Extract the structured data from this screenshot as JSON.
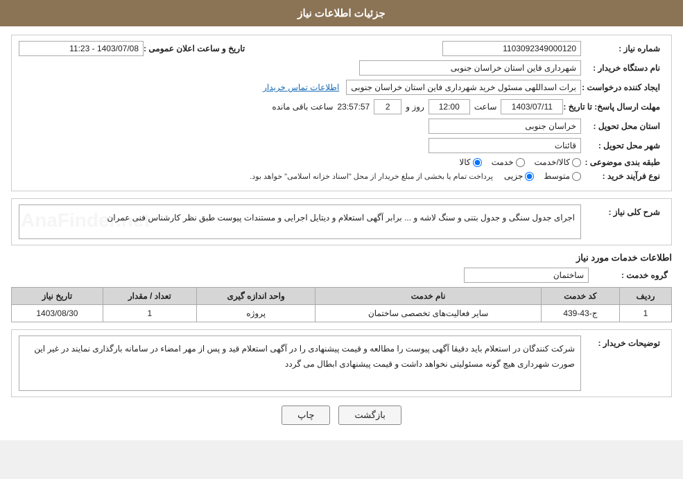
{
  "header": {
    "title": "جزئیات اطلاعات نیاز"
  },
  "fields": {
    "need_number_label": "شماره نیاز :",
    "need_number_value": "1103092349000120",
    "announcement_date_label": "تاریخ و ساعت اعلان عمومی :",
    "announcement_date_value": "1403/07/08 - 11:23",
    "buyer_org_label": "نام دستگاه خریدار :",
    "buyer_org_value": "شهرداری فاین استان خراسان جنوبی",
    "creator_label": "ایجاد کننده درخواست :",
    "creator_value": "برات اسداللهی مسئول خرید شهرداری فاین استان خراسان جنوبی",
    "creator_link": "اطلاعات تماس خریدار",
    "response_deadline_label": "مهلت ارسال پاسخ: تا تاریخ :",
    "response_date": "1403/07/11",
    "response_time_label": "ساعت",
    "response_time": "12:00",
    "response_days_label": "روز و",
    "response_days": "2",
    "response_remaining_label": "ساعت باقی مانده",
    "response_remaining": "23:57:57",
    "delivery_province_label": "استان محل تحویل :",
    "delivery_province_value": "خراسان جنوبی",
    "delivery_city_label": "شهر محل تحویل :",
    "delivery_city_value": "قائنات",
    "category_label": "طبقه بندی موضوعی :",
    "category_options": [
      "کالا",
      "خدمت",
      "کالا/خدمت"
    ],
    "category_selected": "کالا",
    "process_label": "نوع فرآیند خرید :",
    "process_options": [
      "جزیی",
      "متوسط"
    ],
    "process_note": "پرداخت تمام یا بخشی از مبلغ خریدار از محل \"اسناد خزانه اسلامی\" خواهد بود.",
    "description_label": "شرح کلی نیاز :",
    "description_value": "اجرای جدول سنگی و جدول بتنی و سنگ لاشه و ... برابر آگهی استعلام و دیتایل اجرایی و مستندات پیوست طبق نظر کارشناس فنی عمران",
    "services_section_title": "اطلاعات خدمات مورد نیاز",
    "service_group_label": "گروه خدمت :",
    "service_group_value": "ساختمان",
    "table": {
      "headers": [
        "ردیف",
        "کد خدمت",
        "نام خدمت",
        "واحد اندازه گیری",
        "تعداد / مقدار",
        "تاریخ نیاز"
      ],
      "rows": [
        {
          "row": "1",
          "code": "ج-43-439",
          "name": "سایر فعالیت‌های تخصصی ساختمان",
          "unit": "پروژه",
          "count": "1",
          "date": "1403/08/30"
        }
      ]
    },
    "buyer_notes_label": "توضیحات خریدار :",
    "buyer_notes_value": "شرکت کنندگان در استعلام باید دقیقا آگهی پیوست را مطالعه و قیمت پیشنهادی را در آگهی استعلام قید و پس از مهر امضاء در سامانه بارگذاری نمایند در غیر این صورت شهرداری هیچ گونه مسئولیتی نخواهد داشت و قیمت پیشنهادی ابطال می گردد"
  },
  "buttons": {
    "back_label": "بازگشت",
    "print_label": "چاپ"
  }
}
